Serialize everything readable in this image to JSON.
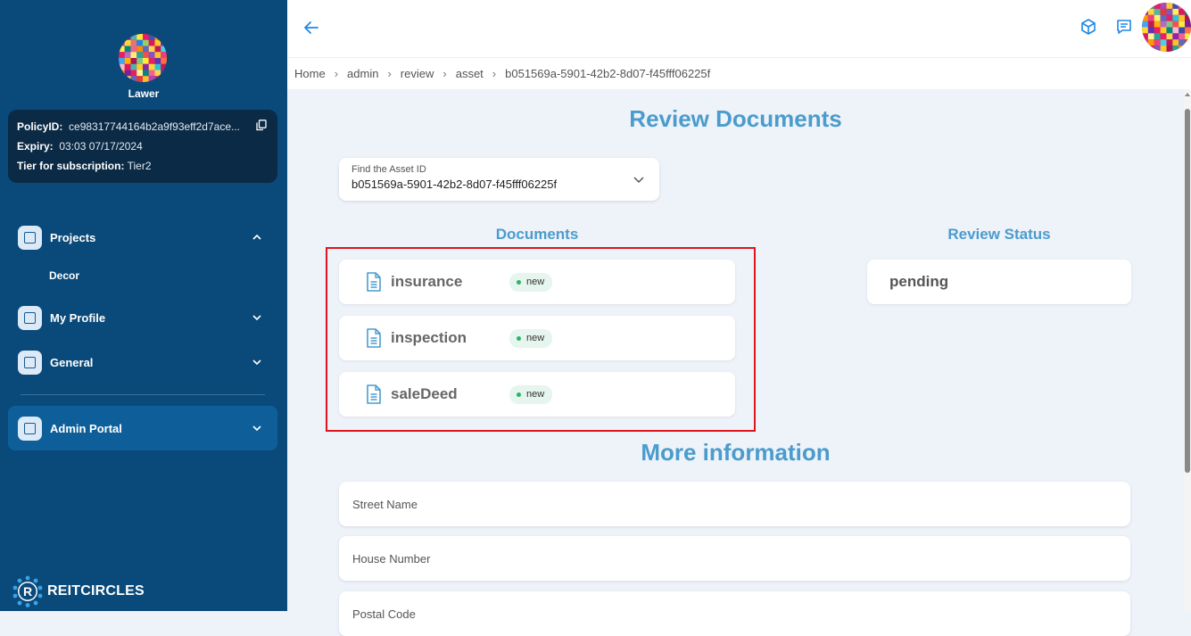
{
  "sidebar": {
    "user_name": "Lawer",
    "policy": {
      "policy_label": "PolicyID:",
      "policy_value": "ce98317744164b2a9f93eff2d7ace...",
      "expiry_label": "Expiry:",
      "expiry_value": "03:03 07/17/2024",
      "tier_label": "Tier for subscription:",
      "tier_value": "Tier2"
    },
    "items": [
      {
        "label": "Projects"
      },
      {
        "label": "My Profile"
      },
      {
        "label": "General"
      },
      {
        "label": "Admin Portal"
      }
    ],
    "sub_item": "Decor",
    "brand": "REITCIRCLES"
  },
  "breadcrumb": [
    "Home",
    "admin",
    "review",
    "asset",
    "b051569a-5901-42b2-8d07-f45fff06225f"
  ],
  "main": {
    "title": "Review Documents",
    "asset_select": {
      "label": "Find the Asset ID",
      "value": "b051569a-5901-42b2-8d07-f45fff06225f"
    },
    "documents_title": "Documents",
    "documents": [
      {
        "name": "insurance",
        "badge": "new"
      },
      {
        "name": "inspection",
        "badge": "new"
      },
      {
        "name": "saleDeed",
        "badge": "new"
      }
    ],
    "review_status_title": "Review Status",
    "review_status": "pending",
    "more_info_title": "More information",
    "fields": [
      {
        "label": "Street Name"
      },
      {
        "label": "House Number"
      },
      {
        "label": "Postal Code"
      }
    ]
  },
  "colors": {
    "sidebar": "#0a4a7a",
    "accent": "#4a9ccd",
    "highlight": "#e0141c",
    "badge_dot": "#2cb36b"
  }
}
